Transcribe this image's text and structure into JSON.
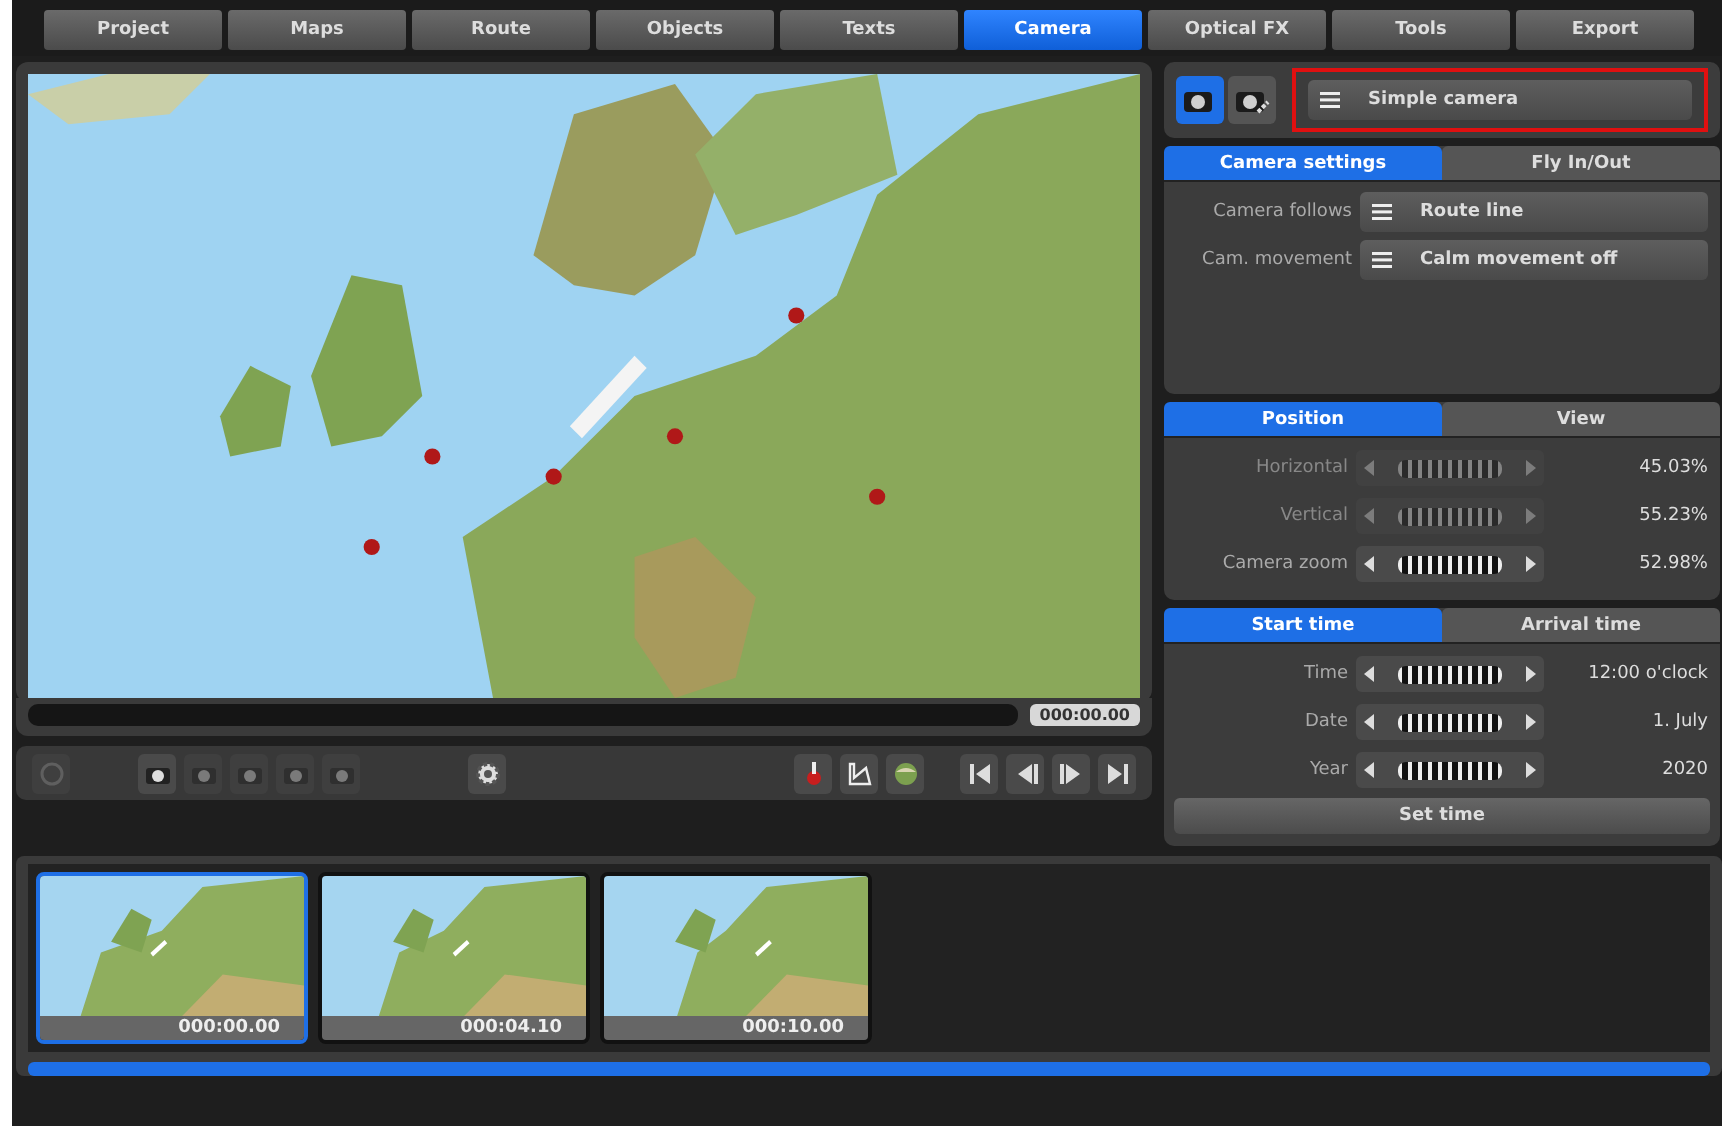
{
  "tabs": [
    {
      "label": "Project",
      "selected": false
    },
    {
      "label": "Maps",
      "selected": false
    },
    {
      "label": "Route",
      "selected": false
    },
    {
      "label": "Objects",
      "selected": false
    },
    {
      "label": "Texts",
      "selected": false
    },
    {
      "label": "Camera",
      "selected": true
    },
    {
      "label": "Optical FX",
      "selected": false
    },
    {
      "label": "Tools",
      "selected": false
    },
    {
      "label": "Export",
      "selected": false
    }
  ],
  "preview": {
    "kind": "picture",
    "timecode": "000:00.00"
  },
  "toolbar": [
    {
      "kind": "target",
      "disabled": true
    },
    {
      "kind": "camera",
      "disabled": false
    },
    {
      "kind": "camera",
      "disabled": true
    },
    {
      "kind": "camera",
      "disabled": true
    },
    {
      "kind": "camera",
      "disabled": true
    },
    {
      "kind": "camera",
      "disabled": true
    },
    {
      "kind": "gear",
      "disabled": false
    },
    {
      "kind": "pin",
      "disabled": false
    },
    {
      "kind": "ruler",
      "disabled": false
    },
    {
      "kind": "globe",
      "disabled": false
    },
    {
      "kind": "first",
      "disabled": false
    },
    {
      "kind": "prev",
      "disabled": false
    },
    {
      "kind": "next",
      "disabled": false
    },
    {
      "kind": "last",
      "disabled": false
    }
  ],
  "camera_modes": [
    {
      "kind": "camera",
      "selected": true
    },
    {
      "kind": "camera-path",
      "selected": false
    }
  ],
  "camera_type": {
    "value": "Simple camera",
    "highlighted": true
  },
  "settings_tabs": [
    {
      "label": "Camera settings",
      "selected": true
    },
    {
      "label": "Fly In/Out",
      "selected": false
    }
  ],
  "settings": [
    {
      "label": "Camera follows",
      "value": "Route line"
    },
    {
      "label": "Cam. movement",
      "value": "Calm movement off"
    }
  ],
  "position_tabs": [
    {
      "label": "Position",
      "selected": true
    },
    {
      "label": "View",
      "selected": false
    }
  ],
  "position_sliders": [
    {
      "label": "Horizontal",
      "reading": "45.03%",
      "disabled": true
    },
    {
      "label": "Vertical",
      "reading": "55.23%",
      "disabled": true
    },
    {
      "label": "Camera zoom",
      "reading": "52.98%",
      "disabled": false
    }
  ],
  "time_tabs": [
    {
      "label": "Start time",
      "selected": true
    },
    {
      "label": "Arrival time",
      "selected": false
    }
  ],
  "time_sliders": [
    {
      "label": "Time",
      "reading": "12:00 o'clock",
      "disabled": false
    },
    {
      "label": "Date",
      "reading": "1. July",
      "disabled": false
    },
    {
      "label": "Year",
      "reading": "2020",
      "disabled": false
    }
  ],
  "set_time_button": "Set time",
  "keyframes": [
    {
      "time": "000:00.00",
      "selected": true
    },
    {
      "time": "000:04.10",
      "selected": false
    },
    {
      "time": "000:10.00",
      "selected": false
    }
  ]
}
